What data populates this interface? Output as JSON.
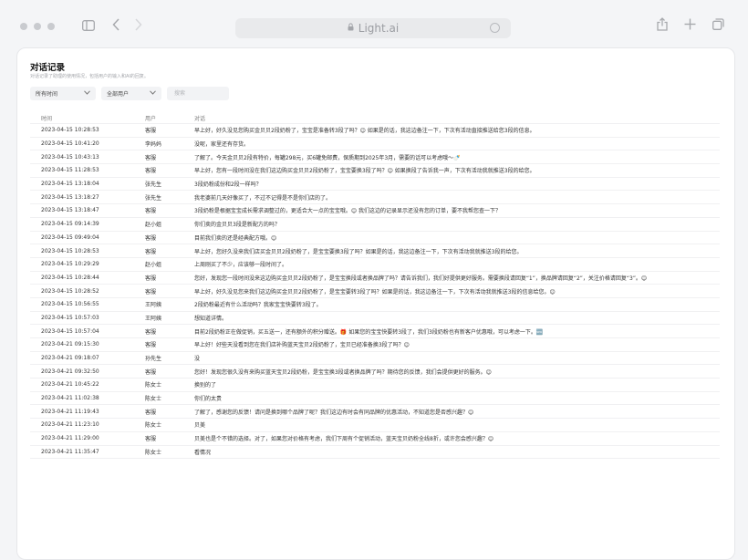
{
  "window": {
    "url": "Light.ai"
  },
  "panel": {
    "title": "对话记录",
    "subtitle": "对话记录了助理的使用情况，包括用户的输入和AI的回复。",
    "filters": {
      "time": "所有时间",
      "user": "全部用户",
      "search_placeholder": "搜索"
    }
  },
  "table": {
    "headers": {
      "time": "时间",
      "user": "用户",
      "message": "对话"
    },
    "rows": [
      {
        "time": "2023-04-15 10:28:53",
        "user": "客服",
        "message": "早上好，好久没见您购买金贝贝2段奶粉了，宝宝是准备转3段了吗？😊 如果是的话，我这边备注一下，下次有活动直接推送给您3段的信息。"
      },
      {
        "time": "2023-04-15 10:41:20",
        "user": "李妈妈",
        "message": "没呢，家里还有存货。"
      },
      {
        "time": "2023-04-15 10:43:13",
        "user": "客服",
        "message": "了解了。今天金贝贝2段有特价，每罐298元，买6罐免邮费，保质期到2025年3月，需要的话可以考虑哦～🍼"
      },
      {
        "time": "2023-04-15 11:28:53",
        "user": "客服",
        "message": "早上好，您有一段时间没在我们这边购买金贝贝2段奶粉了，宝宝要换3段了吗？😊 如果换段了告诉我一声，下次有活动我就推送3段的给您。"
      },
      {
        "time": "2023-04-15 13:18:04",
        "user": "张先生",
        "message": "3段奶粉成份和2段一样吗？"
      },
      {
        "time": "2023-04-15 13:18:27",
        "user": "张先生",
        "message": "我老婆前几天好像买了，不过不记得是不是你们店的了。"
      },
      {
        "time": "2023-04-15 13:18:47",
        "user": "客服",
        "message": "3段奶粉是根据宝宝成长需求调整过的，更适合大一点的宝宝哦。😊 我们这边的记录显示还没有您的订单，要不我帮您查一下？"
      },
      {
        "time": "2023-04-15 09:14:39",
        "user": "赵小姐",
        "message": "你们卖的金贝贝3段是新配方的吗？"
      },
      {
        "time": "2023-04-15 09:49:04",
        "user": "客服",
        "message": "目前我们卖的还是经典配方哦。😊"
      },
      {
        "time": "2023-04-15 10:28:53",
        "user": "客服",
        "message": "早上好，您好久没来我们店买金贝贝2段奶粉了，是宝宝要换3段了吗？如果是的话，我这边备注一下，下次有活动我就推送3段的给您。"
      },
      {
        "time": "2023-04-15 10:29:29",
        "user": "赵小姐",
        "message": "上周刚买了不少，应该够一段时间了。"
      },
      {
        "time": "2023-04-15 10:28:44",
        "user": "客服",
        "message": "您好，发现您一段时间没来这边购买金贝贝2段奶粉了，是宝宝换段或者换品牌了吗？请告诉我们，我们好提供更好服务。需要换段请回复“1”，换品牌请回复“2”，关注价格请回复“3”。😊"
      },
      {
        "time": "2023-04-15 10:28:52",
        "user": "客服",
        "message": "早上好，好久没见您来我们这边购买金贝贝2段奶粉了，是宝宝要转3段了吗？如果是的话，我这边备注一下，下次有活动我就推送3段的信息给您。😊"
      },
      {
        "time": "2023-04-15 10:56:55",
        "user": "王阿姨",
        "message": "2段奶粉最近有什么活动吗？我家宝宝快要转3段了。"
      },
      {
        "time": "2023-04-15 10:57:03",
        "user": "王阿姨",
        "message": "想知道详情。"
      },
      {
        "time": "2023-04-15 10:57:04",
        "user": "客服",
        "message": "目前2段奶粉正在做促销，买五送一，还有额外的积分赠送。🎁 如果您的宝宝快要转3段了，我们3段奶粉也有新客户优惠哦，可以考虑一下。🆕"
      },
      {
        "time": "2023-04-21 09:15:30",
        "user": "客服",
        "message": "早上好！好些天没看到您在我们店补购蓝天宝贝2段奶粉了，宝贝已经准备换3段了吗？😊"
      },
      {
        "time": "2023-04-21 09:18:07",
        "user": "孙先生",
        "message": "没"
      },
      {
        "time": "2023-04-21 09:32:50",
        "user": "客服",
        "message": "您好！发现您很久没有来购买蓝天宝贝2段奶粉，是宝宝换3段或者换品牌了吗？期待您的反馈，我们会提供更好的服务。😊"
      },
      {
        "time": "2023-04-21 10:45:22",
        "user": "陈女士",
        "message": "换别的了"
      },
      {
        "time": "2023-04-21 11:02:38",
        "user": "陈女士",
        "message": "你们的太贵"
      },
      {
        "time": "2023-04-21 11:19:43",
        "user": "客服",
        "message": "了解了，感谢您的反馈！请问是换到哪个品牌了呢？我们这边有时会有同品牌的优惠活动，不知道您是否感兴趣？😊"
      },
      {
        "time": "2023-04-21 11:23:10",
        "user": "陈女士",
        "message": "贝美"
      },
      {
        "time": "2023-04-21 11:29:00",
        "user": "客服",
        "message": "贝美也是个不错的选择。对了，如果您对价格有考虑，我们下周有个促销活动，蓝天宝贝奶粉全线8折，或许您会感兴趣？😊"
      },
      {
        "time": "2023-04-21 11:35:47",
        "user": "陈女士",
        "message": "看情况"
      }
    ]
  }
}
